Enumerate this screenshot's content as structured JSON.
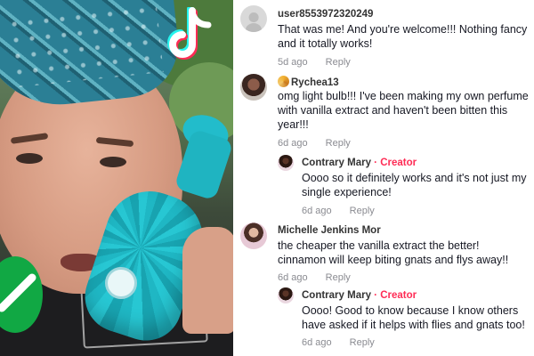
{
  "comments": [
    {
      "username": "user8553972320249",
      "lines": [
        "That was me! And you're welcome!!! Nothing fancy",
        "and it totally works!"
      ],
      "age": "5d ago",
      "reply_label": "Reply"
    },
    {
      "username": "Rychea13",
      "lines": [
        "omg light bulb!!! I've been making my own perfume",
        "with vanilla extract and haven't been bitten this",
        "year!!!"
      ],
      "age": "6d ago",
      "reply_label": "Reply"
    },
    {
      "username": "Contrary Mary",
      "badge": "Creator",
      "lines": [
        "Oooo so it definitely works and it's not just my",
        "single experience!"
      ],
      "age": "6d ago",
      "reply_label": "Reply"
    },
    {
      "username": "Michelle Jenkins Mor",
      "lines": [
        "the cheaper the vanilla extract the better!",
        "cinnamon will keep biting gnats and flys away!!"
      ],
      "age": "6d ago",
      "reply_label": "Reply"
    },
    {
      "username": "Contrary Mary",
      "badge": "Creator",
      "lines": [
        "Oooo! Good to know because I know others",
        "have asked if it helps with flies and gnats too!"
      ],
      "age": "6d ago",
      "reply_label": "Reply"
    }
  ],
  "colors": {
    "creator_badge": "#fe2c55",
    "check_badge": "#11a844",
    "bottle": "#1fb7c4"
  },
  "icons": {
    "video_logo": "tiktok-icon",
    "overlay": "check-icon"
  }
}
